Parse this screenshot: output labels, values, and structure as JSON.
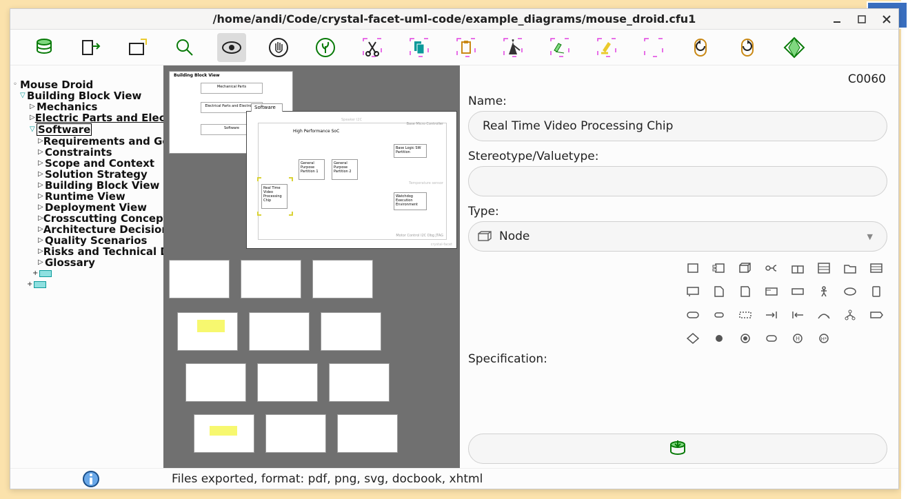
{
  "window": {
    "title": "/home/andi/Code/crystal-facet-uml-code/example_diagrams/mouse_droid.cfu1"
  },
  "tree": {
    "root": "Mouse Droid",
    "l1": "Building Block View",
    "items": [
      "Mechanics",
      "Electric Parts and Electronics",
      "Software"
    ],
    "sw_children": [
      "Requirements and Goals",
      "Constraints",
      "Scope and Context",
      "Solution Strategy",
      "Building Block View",
      "Runtime View",
      "Deployment View",
      "Crosscutting Concepts",
      "Architecture Decisions",
      "Quality Scenarios",
      "Risks and Technical Debts",
      "Glossary"
    ]
  },
  "canvas": {
    "stack_top_title": "Building Block View",
    "stack_mid_title": "Mechanical Parts",
    "stack_low_title": "Electrical Parts and Electronics",
    "tab_label": "Software",
    "main_title": "High Performance SoC",
    "box1": "Real Time\nVideo\nProcessing\nChip",
    "box2": "General\nPurpose\nPartition 1",
    "box3": "General\nPurpose\nPartition 2",
    "box4": "Base Logic SW\nPartition",
    "box5": "Watchdog\nExecution\nEnvironment",
    "outer_right": "Base Micro Controller",
    "speaker": "Speaker I2C",
    "temp": "Temperature sensor",
    "footer": "Motor Control I2C Dbg JTAG",
    "logo": "crystal-facet"
  },
  "props": {
    "id": "C0060",
    "name_label": "Name:",
    "name_value": "Real Time Video Processing Chip",
    "stereo_label": "Stereotype/Valuetype:",
    "stereo_value": "",
    "type_label": "Type:",
    "type_value": "Node",
    "spec_label": "Specification:"
  },
  "status": {
    "text": "Files exported, format: pdf, png, svg, docbook, xhtml"
  }
}
